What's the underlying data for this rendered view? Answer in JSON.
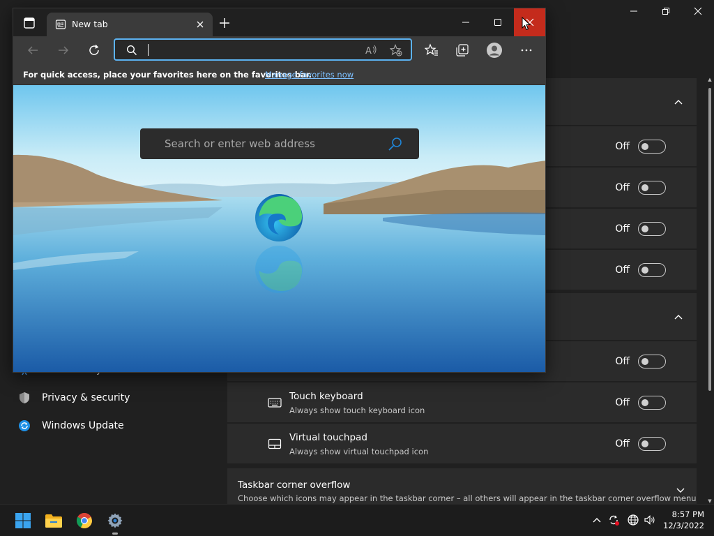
{
  "settings": {
    "nav": [
      {
        "label": "Accessibility",
        "icon": "accessibility-icon"
      },
      {
        "label": "Privacy & security",
        "icon": "shield-icon"
      },
      {
        "label": "Windows Update",
        "icon": "windows-update-icon"
      }
    ],
    "toggle_off_label": "Off",
    "touch_keyboard": {
      "title": "Touch keyboard",
      "subtitle": "Always show touch keyboard icon"
    },
    "virtual_touchpad": {
      "title": "Virtual touchpad",
      "subtitle": "Always show virtual touchpad icon"
    },
    "overflow": {
      "title": "Taskbar corner overflow",
      "subtitle": "Choose which icons may appear in the taskbar corner – all others will appear in the taskbar corner overflow menu"
    }
  },
  "edge": {
    "tab_title": "New tab",
    "address_value": "",
    "favorites_prompt": "For quick access, place your favorites here on the favorites bar.",
    "favorites_link": "Manage favorites now",
    "ntp_search_placeholder": "Search or enter web address",
    "accent_color": "#5cb2f0",
    "close_color": "#c42b1c"
  },
  "taskbar": {
    "apps": [
      "windows-start-icon",
      "file-explorer-icon",
      "chrome-icon",
      "settings-gear-icon"
    ],
    "time": "8:57 PM",
    "date": "12/3/2022"
  }
}
